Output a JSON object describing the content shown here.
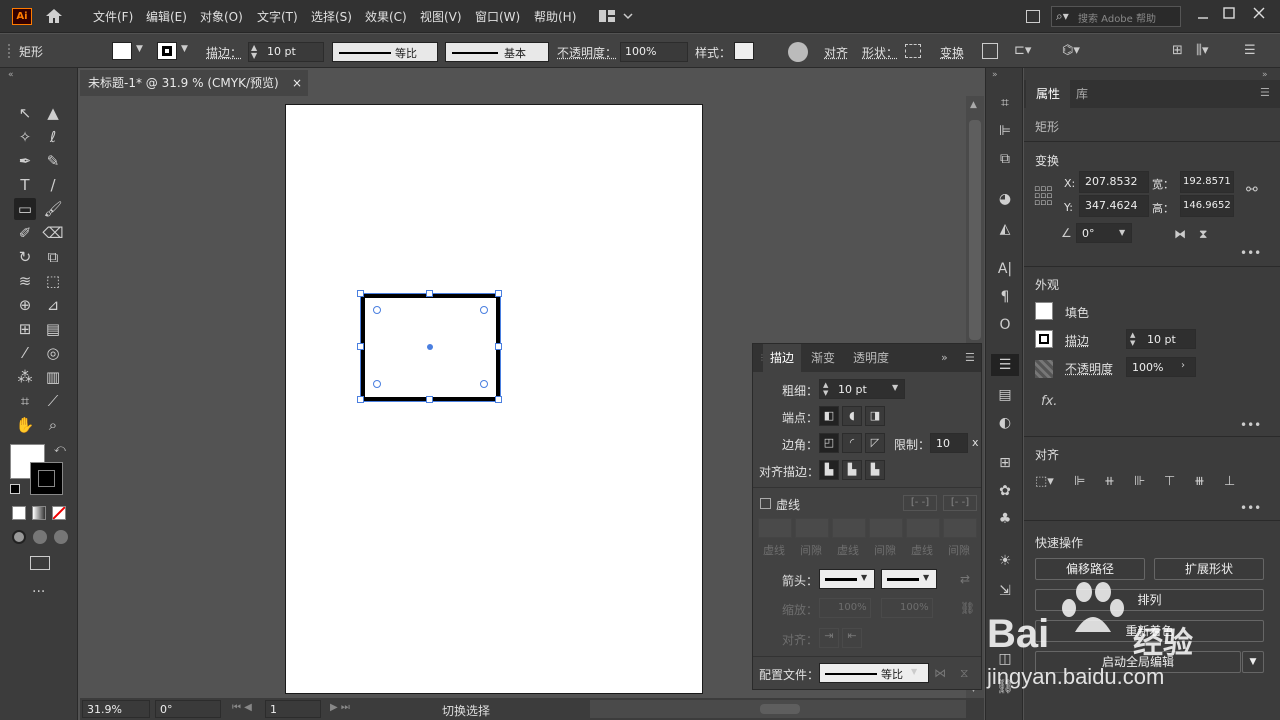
{
  "app": {
    "logo": "Ai"
  },
  "menu": [
    "文件(F)",
    "编辑(E)",
    "对象(O)",
    "文字(T)",
    "选择(S)",
    "效果(C)",
    "视图(V)",
    "窗口(W)",
    "帮助(H)"
  ],
  "search": {
    "placeholder": "搜索 Adobe 帮助"
  },
  "control": {
    "tool_name": "矩形",
    "stroke_label": "描边：",
    "stroke_weight": "10 pt",
    "profile": "等比",
    "brush": "基本",
    "opacity_label": "不透明度：",
    "opacity": "100%",
    "style_label": "样式：",
    "align": "对齐",
    "shape_label": "形状：",
    "transform": "变换"
  },
  "document": {
    "tab_title": "未标题-1* @ 31.9 % (CMYK/预览)"
  },
  "status": {
    "zoom": "31.9%",
    "rotation": "0°",
    "page": "1",
    "status_text": "切换选择"
  },
  "properties": {
    "tab_props": "属性",
    "tab_library": "库",
    "object_type": "矩形",
    "transform_title": "变换",
    "x_label": "X:",
    "x": "207.8532",
    "y_label": "Y:",
    "y": "347.4624",
    "w_label": "宽：",
    "w": "192.8571",
    "h_label": "高：",
    "h": "146.9652",
    "angle": "0°",
    "appearance_title": "外观",
    "fill": "填色",
    "stroke": "描边",
    "stroke_weight": "10 pt",
    "opacity_label": "不透明度",
    "opacity": "100%",
    "fx": "fx.",
    "align_title": "对齐",
    "quick_title": "快速操作",
    "offset_path": "偏移路径",
    "expand_shape": "扩展形状",
    "arrange": "排列",
    "recolor": "重新着色",
    "global_edit": "启动全局编辑"
  },
  "stroke_panel": {
    "tab_stroke": "描边",
    "tab_gradient": "渐变",
    "tab_transparency": "透明度",
    "weight_label": "粗细：",
    "weight": "10 pt",
    "cap_label": "端点：",
    "corner_label": "边角：",
    "limit_label": "限制：",
    "limit": "10",
    "limit_unit": "x",
    "align_label": "对齐描边：",
    "dashed_label": "虚线",
    "dash_labels": [
      "虚线",
      "间隙",
      "虚线",
      "间隙",
      "虚线",
      "间隙"
    ],
    "arrow_label": "箭头：",
    "scale_label": "缩放：",
    "scale1": "100%",
    "scale2": "100%",
    "align2_label": "对齐：",
    "profile_label": "配置文件：",
    "profile": "等比"
  },
  "watermark": {
    "brand": "Bai",
    "brand2": "经验",
    "url": "jingyan.baidu.com"
  }
}
